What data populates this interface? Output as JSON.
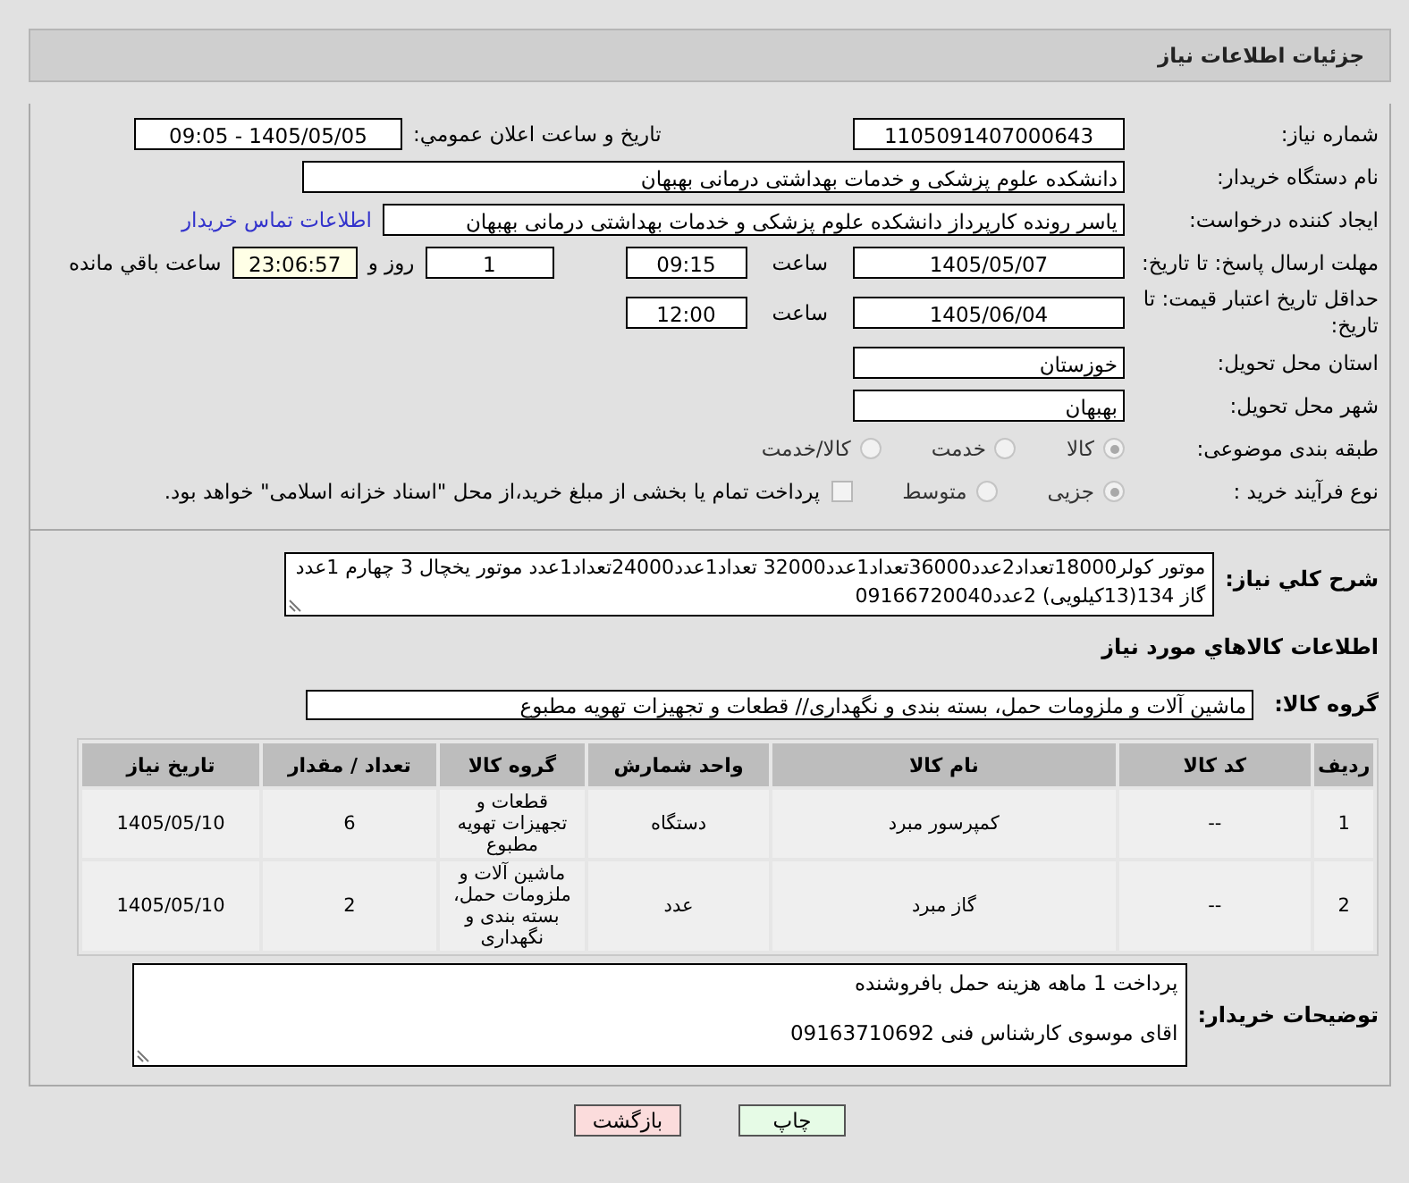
{
  "header": {
    "title": "جزئیات اطلاعات نیاز"
  },
  "need_number": {
    "label": "شماره نیاز:",
    "value": "1105091407000643"
  },
  "announce": {
    "label": "تاریخ و ساعت اعلان عمومي:",
    "value": "1405/05/05 - 09:05"
  },
  "buyer_org": {
    "label": "نام دستگاه خریدار:",
    "value": "دانشکده علوم پزشکی و خدمات بهداشتی  درمانی بهبهان"
  },
  "requester": {
    "label": "ایجاد کننده درخواست:",
    "value": "یاسر رونده کارپرداز دانشکده علوم پزشکی و خدمات بهداشتی  درمانی بهبهان",
    "link": "اطلاعات تماس خریدار"
  },
  "deadline": {
    "label": "مهلت ارسال پاسخ: تا تاریخ:",
    "date": "1405/05/07",
    "time_label": "ساعت",
    "time": "09:15",
    "days": "1",
    "days_label": "روز و",
    "remaining": "23:06:57",
    "remaining_label": "ساعت باقي مانده"
  },
  "validity": {
    "label": "حداقل تاریخ اعتبار قیمت: تا تاریخ:",
    "date": "1405/06/04",
    "time_label": "ساعت",
    "time": "12:00"
  },
  "province": {
    "label": "استان محل تحویل:",
    "value": "خوزستان"
  },
  "city": {
    "label": "شهر محل تحویل:",
    "value": "بهبهان"
  },
  "category": {
    "label": "طبقه بندی موضوعی:",
    "options": [
      {
        "label": "کالا",
        "selected": true
      },
      {
        "label": "خدمت",
        "selected": false
      },
      {
        "label": "کالا/خدمت",
        "selected": false
      }
    ]
  },
  "process": {
    "label": "نوع فرآیند خرید :",
    "options": [
      {
        "label": "جزیی",
        "selected": true
      },
      {
        "label": "متوسط",
        "selected": false
      }
    ],
    "payment": {
      "checked": false,
      "text": "پرداخت تمام یا بخشی از مبلغ خرید،از محل \"اسناد خزانه اسلامی\" خواهد بود."
    }
  },
  "description": {
    "label": "شرح کلي نياز:",
    "value": "موتور کولر18000تعداد2عدد36000تعداد1عدد32000 تعداد1عدد24000تعداد1عدد موتور یخچال 3 چهارم 1عدد گاز 134(13کیلویی) 2عدد09166720040"
  },
  "goods_heading": "اطلاعات کالاهاي مورد نياز",
  "goods_group": {
    "label": "گروه کالا:",
    "value": "ماشین آلات و ملزومات حمل، بسته بندی و نگهداری//  قطعات و تجهیزات تهویه مطبوع"
  },
  "table": {
    "columns": [
      "ردیف",
      "کد کالا",
      "نام کالا",
      "واحد شمارش",
      "گروه کالا",
      "تعداد / مقدار",
      "تاریخ نیاز"
    ],
    "rows": [
      [
        "1",
        "--",
        "کمپرسور مبرد",
        "دستگاه",
        "قطعات و تجهیزات تهویه مطبوع",
        "6",
        "1405/05/10"
      ],
      [
        "2",
        "--",
        "گاز مبرد",
        "عدد",
        "ماشین آلات و ملزومات حمل، بسته بندی و نگهداری",
        "2",
        "1405/05/10"
      ]
    ]
  },
  "buyer_notes": {
    "label": "توضیحات خریدار:",
    "lines": [
      "پرداخت 1 ماهه هزینه حمل بافروشنده",
      "اقای موسوی کارشناس فنی 09163710692"
    ]
  },
  "buttons": [
    {
      "label": "چاپ",
      "kind": "print"
    },
    {
      "label": "بازگشت",
      "kind": "back"
    }
  ]
}
